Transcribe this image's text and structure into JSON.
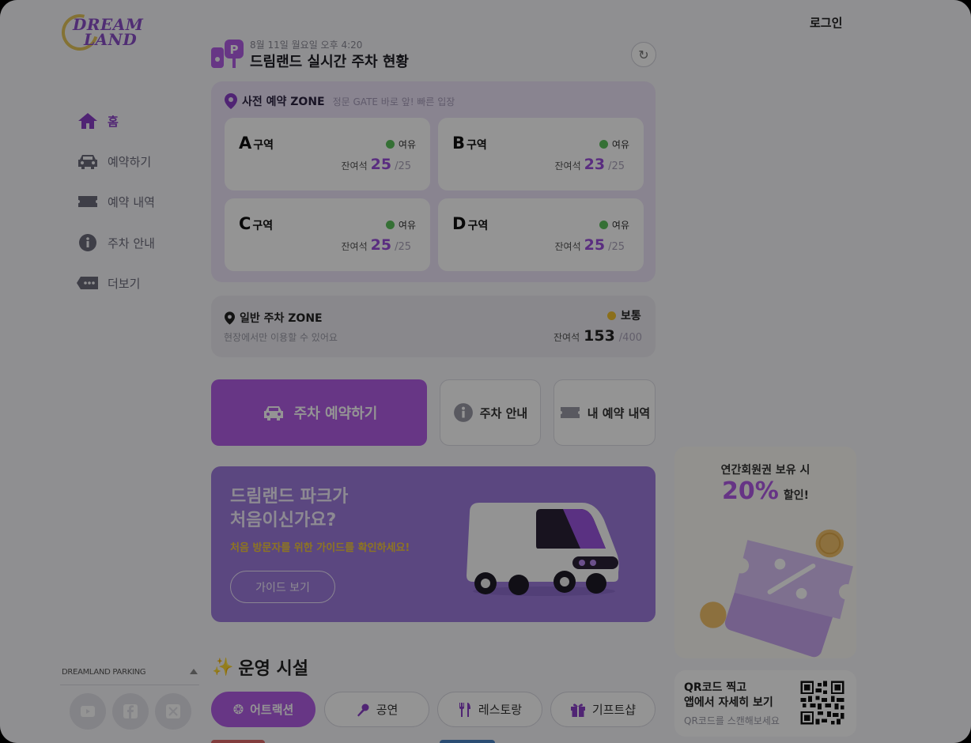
{
  "brand": {
    "logo_line1": "DREAM",
    "logo_line2": "LAND"
  },
  "header": {
    "login_label": "로그인"
  },
  "sidebar": {
    "items": [
      {
        "label": "홈",
        "icon": "home-icon",
        "active": true
      },
      {
        "label": "예약하기",
        "icon": "car-icon",
        "active": false
      },
      {
        "label": "예약 내역",
        "icon": "ticket-icon",
        "active": false
      },
      {
        "label": "주차 안내",
        "icon": "info-icon",
        "active": false
      },
      {
        "label": "더보기",
        "icon": "more-icon",
        "active": false
      }
    ],
    "footer_label": "DREAMLAND PARKING",
    "social": [
      "youtube-icon",
      "facebook-icon",
      "x-icon"
    ]
  },
  "status": {
    "date": "8월 11일 월요일 오후 4:20",
    "title": "드림랜드 실시간 주차 현황"
  },
  "reserved_zone": {
    "title": "사전 예약 ZONE",
    "subtitle": "정문 GATE 바로 앞! 빠른 입장",
    "zones": [
      {
        "letter": "A",
        "suffix": "구역",
        "status": "여유",
        "status_color": "#5cc15c",
        "remain_label": "잔여석",
        "remaining": "25",
        "total": "/25"
      },
      {
        "letter": "B",
        "suffix": "구역",
        "status": "여유",
        "status_color": "#5cc15c",
        "remain_label": "잔여석",
        "remaining": "23",
        "total": "/25"
      },
      {
        "letter": "C",
        "suffix": "구역",
        "status": "여유",
        "status_color": "#5cc15c",
        "remain_label": "잔여석",
        "remaining": "25",
        "total": "/25"
      },
      {
        "letter": "D",
        "suffix": "구역",
        "status": "여유",
        "status_color": "#5cc15c",
        "remain_label": "잔여석",
        "remaining": "25",
        "total": "/25"
      }
    ]
  },
  "general_zone": {
    "title": "일반 주차 ZONE",
    "subtitle": "현장에서만 이용할 수 있어요",
    "status": "보통",
    "status_color": "#f0c030",
    "remain_label": "잔여석",
    "remaining": "153",
    "total": "/400"
  },
  "actions": {
    "reserve": "주차 예약하기",
    "guide": "주차 안내",
    "my_reservations": "내 예약 내역"
  },
  "banner": {
    "title_line1": "드림랜드 파크가",
    "title_line2": "처음이신가요?",
    "subtitle": "처음 방문자를 위한 가이드를 확인하세요!",
    "button": "가이드 보기"
  },
  "facilities": {
    "title": "운영 시설",
    "tabs": [
      {
        "label": "어트랙션",
        "icon": "attraction-icon",
        "active": true
      },
      {
        "label": "공연",
        "icon": "microphone-icon",
        "active": false
      },
      {
        "label": "레스토랑",
        "icon": "fork-knife-icon",
        "active": false
      },
      {
        "label": "기프트샵",
        "icon": "gift-icon",
        "active": false
      }
    ]
  },
  "ad": {
    "line1": "연간회원권 보유 시",
    "percent": "20%",
    "sale": "할인!"
  },
  "qr": {
    "line1": "QR코드 찍고",
    "line2": "앱에서 자세히 보기",
    "line3": "QR코드를 스캔해보세요"
  },
  "colors": {
    "accent": "#b15ee6",
    "available": "#5cc15c",
    "moderate": "#f0c030"
  }
}
